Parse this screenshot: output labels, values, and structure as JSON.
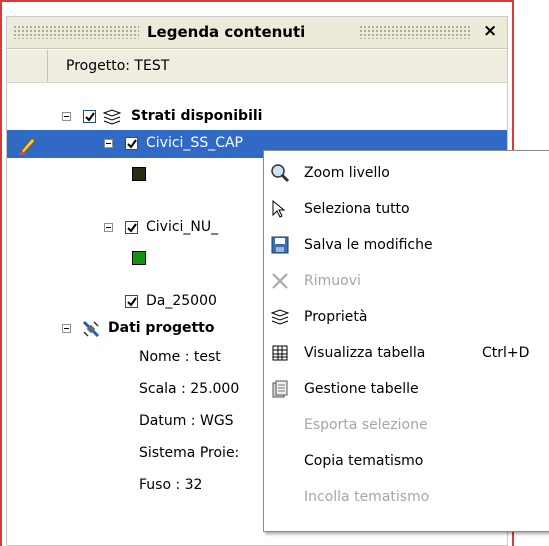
{
  "panel": {
    "title": "Legenda contenuti",
    "close": "×",
    "project_label": "Progetto: TEST"
  },
  "tree": {
    "group1": "Strati disponibili",
    "layer1": "Civici_SS_CAP",
    "layer2": "Civici_NU_",
    "layer3": "Da_25000",
    "group2": "Dati progetto",
    "props": {
      "nome": "Nome : test",
      "scala": "Scala : 25.000",
      "datum": "Datum : WGS",
      "sistema": "Sistema Proie:",
      "fuso": "Fuso : 32"
    },
    "colors": {
      "layer1_swatch": "#2b2d0f",
      "layer2_swatch": "#149214",
      "selection": "#316ac5"
    }
  },
  "menu": {
    "zoom": "Zoom livello",
    "seleziona": "Seleziona tutto",
    "salva": "Salva le modifiche",
    "rimuovi": "Rimuovi",
    "proprieta": "Proprietà",
    "visualizza": "Visualizza tabella",
    "visualizza_shortcut": "Ctrl+D",
    "gestione": "Gestione tabelle",
    "esporta": "Esporta selezione",
    "copia": "Copia tematismo",
    "incolla": "Incolla tematismo"
  }
}
